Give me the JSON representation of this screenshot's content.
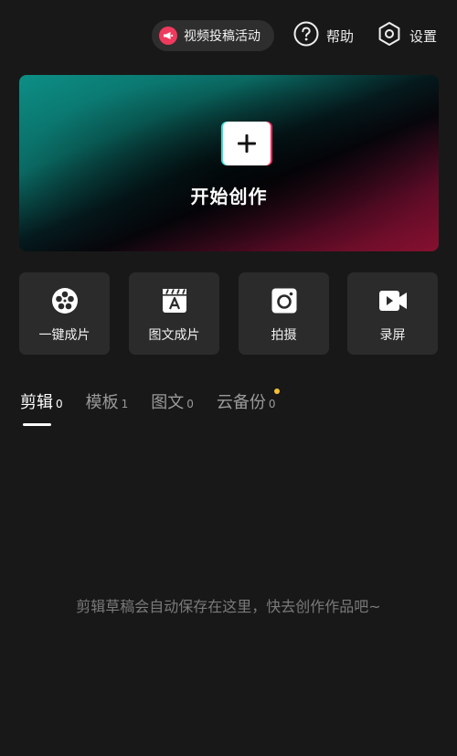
{
  "header": {
    "promo_label": "视频投稿活动",
    "help_label": "帮助",
    "settings_label": "设置"
  },
  "hero": {
    "title": "开始创作"
  },
  "tools": [
    {
      "label": "一键成片",
      "icon": "film-reel-icon"
    },
    {
      "label": "图文成片",
      "icon": "text-clapper-icon"
    },
    {
      "label": "拍摄",
      "icon": "camera-icon"
    },
    {
      "label": "录屏",
      "icon": "video-record-icon"
    }
  ],
  "tabs": [
    {
      "label": "剪辑",
      "count": "0",
      "active": true
    },
    {
      "label": "模板",
      "count": "1",
      "active": false
    },
    {
      "label": "图文",
      "count": "0",
      "active": false
    },
    {
      "label": "云备份",
      "count": "0",
      "active": false,
      "has_dot": true
    }
  ],
  "empty_state": {
    "message": "剪辑草稿会自动保存在这里，快去创作作品吧~"
  },
  "colors": {
    "background": "#181818",
    "card": "#2b2b2b",
    "promo_icon": "#ef3a5d",
    "notification_dot": "#f6c033"
  }
}
